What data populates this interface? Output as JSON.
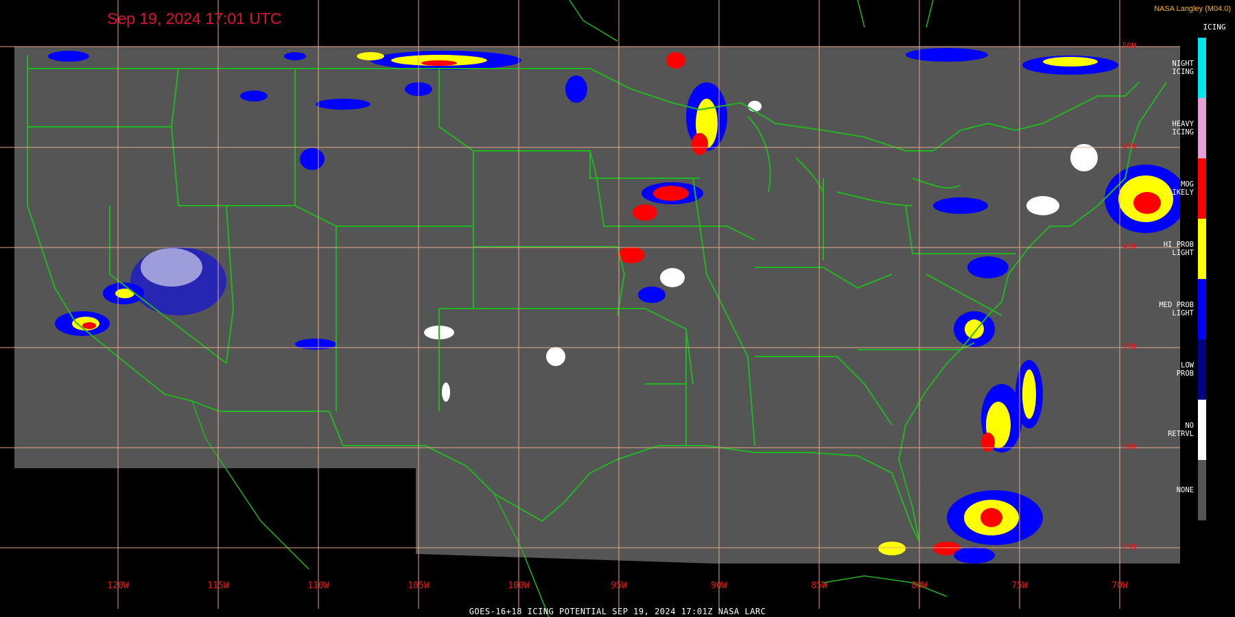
{
  "header": {
    "timestamp": "Sep 19, 2024 17:01 UTC",
    "credit": "NASA Langley (M04.0)"
  },
  "footer": {
    "caption": "GOES-16+18  ICING POTENTIAL   SEP 19, 2024 17:01Z   NASA LARC"
  },
  "legend": {
    "title": "ICING",
    "items": [
      {
        "label": "NIGHT ICING",
        "lines": [
          "NIGHT",
          "ICING"
        ],
        "color": "#00e5ee"
      },
      {
        "label": "HEAVY ICING",
        "lines": [
          "HEAVY",
          "ICING"
        ],
        "color": "#e6a0d6"
      },
      {
        "label": "MOG LIKELY",
        "lines": [
          "MOG",
          "LIKELY"
        ],
        "color": "#ff0000"
      },
      {
        "label": "HI PROB LIGHT",
        "lines": [
          "HI PROB",
          "LIGHT"
        ],
        "color": "#ffff00"
      },
      {
        "label": "MED PROB LIGHT",
        "lines": [
          "MED PROB",
          "LIGHT"
        ],
        "color": "#0000ff"
      },
      {
        "label": "LOW PROB",
        "lines": [
          "LOW",
          "PROB"
        ],
        "color": "#000080"
      },
      {
        "label": "NO RETRVL",
        "lines": [
          "NO",
          "RETRVL"
        ],
        "color": "#ffffff"
      },
      {
        "label": "NONE",
        "lines": [
          "NONE"
        ],
        "color": "#555555"
      }
    ]
  },
  "map": {
    "background_color": "#000000",
    "data_area_color": "#555555",
    "grid_color": "#e8a888",
    "border_color": "#22b522",
    "longitude_labels": [
      "120W",
      "115W",
      "110W",
      "105W",
      "100W",
      "95W",
      "90W",
      "85W",
      "80W",
      "75W",
      "70W"
    ],
    "latitude_labels": [
      "50N",
      "45N",
      "40N",
      "35N",
      "30N",
      "25N"
    ]
  }
}
